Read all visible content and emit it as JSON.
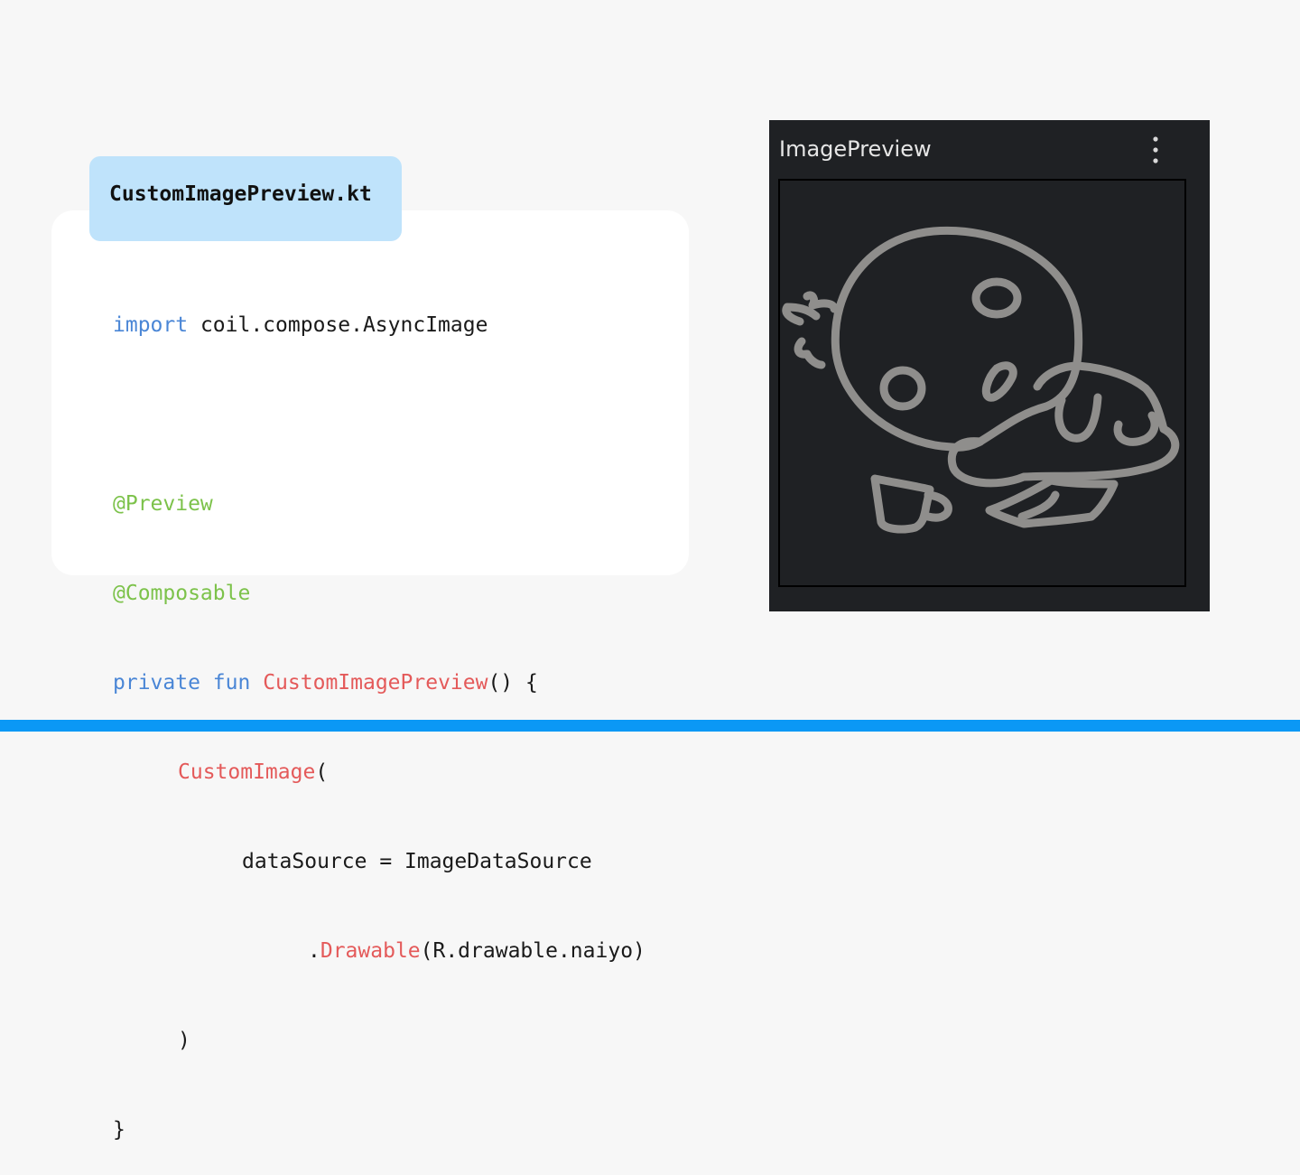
{
  "file_tab": {
    "name": "CustomImagePreview.kt"
  },
  "code": {
    "l1": {
      "kw": "import",
      "rest": " coil.compose.AsyncImage"
    },
    "l3": {
      "ann": "@Preview"
    },
    "l4": {
      "ann": "@Composable"
    },
    "l5": {
      "kw1": "private",
      "kw2": "fun",
      "fn": "CustomImagePreview",
      "rest": "() {"
    },
    "l6": {
      "fn": "CustomImage",
      "rest": "("
    },
    "l7": {
      "text": "dataSource = ImageDataSource"
    },
    "l8": {
      "dot": ".",
      "fn": "Drawable",
      "rest": "(R.drawable.naiyo)"
    },
    "l9": {
      "text": ")"
    },
    "l10": {
      "text": "}"
    }
  },
  "preview": {
    "title": "ImagePreview",
    "menu_icon": "more-vert-icon",
    "image_icon": "sleeping-character-illustration"
  },
  "colors": {
    "background": "#f7f7f7",
    "tab_bg": "#bfe3fb",
    "keyword": "#4a86d6",
    "annotation": "#7cc24a",
    "function": "#e45a5a",
    "preview_bg": "#1f2124",
    "accent_bar": "#0b98f5"
  }
}
